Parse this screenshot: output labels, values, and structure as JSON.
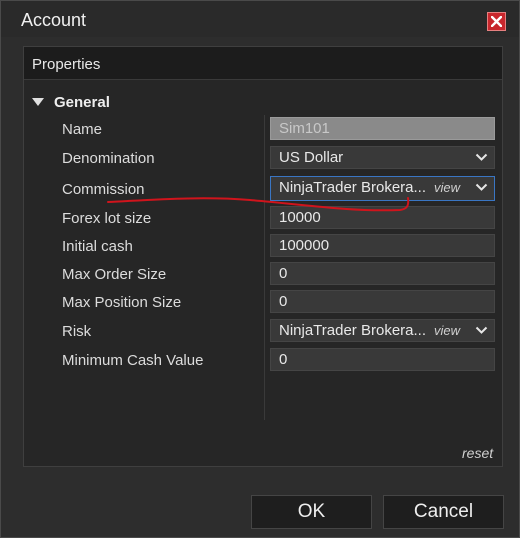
{
  "window": {
    "title": "Account"
  },
  "panel": {
    "header": "Properties"
  },
  "group": {
    "label": "General"
  },
  "properties": [
    {
      "label": "Name",
      "value": "Sim101",
      "type": "text",
      "disabled": true
    },
    {
      "label": "Denomination",
      "value": "US Dollar",
      "type": "select"
    },
    {
      "label": "Commission",
      "value": "NinjaTrader Brokera...",
      "type": "select",
      "link": "view",
      "focused": true
    },
    {
      "label": "Forex lot size",
      "value": "10000",
      "type": "text"
    },
    {
      "label": "Initial cash",
      "value": "100000",
      "type": "text"
    },
    {
      "label": "Max Order Size",
      "value": "0",
      "type": "text"
    },
    {
      "label": "Max Position Size",
      "value": "0",
      "type": "text"
    },
    {
      "label": "Risk",
      "value": "NinjaTrader Brokera...",
      "type": "select",
      "link": "view"
    },
    {
      "label": "Minimum Cash Value",
      "value": "0",
      "type": "text"
    }
  ],
  "links": {
    "reset": "reset"
  },
  "buttons": {
    "ok": "OK",
    "cancel": "Cancel"
  },
  "colors": {
    "close_button": "#c8272d",
    "focus_border": "#3a76c4",
    "annotation_stroke": "#d0141c"
  },
  "icons": {
    "close": "close-icon",
    "group_toggle": "triangle-down-icon",
    "dropdown": "chevron-down-icon"
  }
}
